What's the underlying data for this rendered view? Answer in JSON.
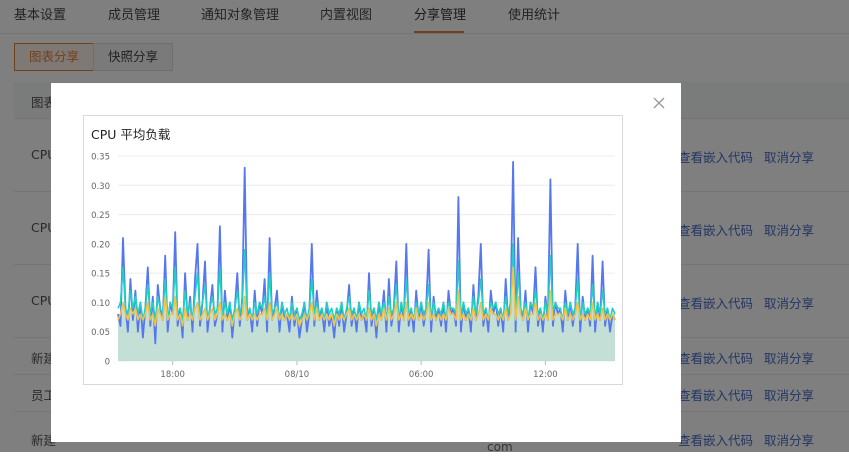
{
  "tabs": [
    {
      "label": "基本设置"
    },
    {
      "label": "成员管理"
    },
    {
      "label": "通知对象管理"
    },
    {
      "label": "内置视图"
    },
    {
      "label": "分享管理"
    },
    {
      "label": "使用统计"
    }
  ],
  "subtabs": [
    {
      "label": "图表分享",
      "active": true
    },
    {
      "label": "快照分享",
      "active": false
    }
  ],
  "table": {
    "header": "图表",
    "rows": [
      {
        "name": "CPU",
        "view_code": "查看嵌入代码",
        "cancel": "取消分享"
      },
      {
        "name": "CPU",
        "view_code": "查看嵌入代码",
        "cancel": "取消分享"
      },
      {
        "name": "CPU",
        "view_code": "查看嵌入代码",
        "cancel": "取消分享"
      },
      {
        "name": "新建",
        "view_code": "查看嵌入代码",
        "cancel": "取消分享"
      },
      {
        "name": "员工",
        "view_code": "查看嵌入代码",
        "cancel": "取消分享"
      },
      {
        "name": "新建",
        "view_code": "查看嵌入代码",
        "cancel": "取消分享",
        "extra": "com"
      }
    ]
  },
  "colors": {
    "accent": "#e6803a",
    "link": "#4a6cc9",
    "series_blue": "#5577f0",
    "series_cyan": "#21d0c2",
    "series_yellow": "#f0c24a",
    "area_fill": "#b9d9cf"
  },
  "icons": {
    "close": "close-icon"
  },
  "chart_data": {
    "type": "line",
    "title": "CPU 平均负载",
    "ylim": [
      0,
      0.35
    ],
    "yticks": [
      "0",
      "0.05",
      "0.10",
      "0.15",
      "0.20",
      "0.25",
      "0.30",
      "0.35"
    ],
    "xticks": [
      {
        "label": "18:00",
        "pos": 0.11
      },
      {
        "label": "08/10",
        "pos": 0.36
      },
      {
        "label": "06:00",
        "pos": 0.61
      },
      {
        "label": "12:00",
        "pos": 0.86
      }
    ],
    "grid": true,
    "series": [
      {
        "key": "s1",
        "color": "#5577f0",
        "values": [
          0.08,
          0.06,
          0.21,
          0.09,
          0.05,
          0.14,
          0.07,
          0.12,
          0.05,
          0.1,
          0.04,
          0.09,
          0.16,
          0.06,
          0.11,
          0.03,
          0.13,
          0.09,
          0.07,
          0.18,
          0.05,
          0.1,
          0.08,
          0.22,
          0.06,
          0.09,
          0.04,
          0.15,
          0.07,
          0.11,
          0.05,
          0.14,
          0.2,
          0.06,
          0.1,
          0.17,
          0.05,
          0.09,
          0.13,
          0.06,
          0.08,
          0.23,
          0.05,
          0.12,
          0.07,
          0.1,
          0.04,
          0.09,
          0.15,
          0.06,
          0.11,
          0.33,
          0.07,
          0.09,
          0.05,
          0.12,
          0.06,
          0.1,
          0.08,
          0.14,
          0.05,
          0.21,
          0.07,
          0.09,
          0.12,
          0.05,
          0.1,
          0.07,
          0.08,
          0.05,
          0.11,
          0.06,
          0.09,
          0.04,
          0.07,
          0.1,
          0.05,
          0.08,
          0.2,
          0.06,
          0.12,
          0.07,
          0.09,
          0.05,
          0.1,
          0.06,
          0.08,
          0.04,
          0.09,
          0.06,
          0.1,
          0.05,
          0.08,
          0.13,
          0.06,
          0.09,
          0.05,
          0.1,
          0.07,
          0.08,
          0.05,
          0.15,
          0.06,
          0.09,
          0.04,
          0.1,
          0.07,
          0.12,
          0.05,
          0.14,
          0.06,
          0.09,
          0.17,
          0.05,
          0.1,
          0.07,
          0.2,
          0.06,
          0.09,
          0.05,
          0.12,
          0.07,
          0.1,
          0.06,
          0.09,
          0.19,
          0.05,
          0.11,
          0.07,
          0.09,
          0.06,
          0.1,
          0.05,
          0.12,
          0.08,
          0.09,
          0.06,
          0.28,
          0.05,
          0.1,
          0.07,
          0.09,
          0.05,
          0.13,
          0.07,
          0.11,
          0.2,
          0.06,
          0.09,
          0.05,
          0.12,
          0.08,
          0.1,
          0.06,
          0.09,
          0.05,
          0.14,
          0.07,
          0.1,
          0.34,
          0.05,
          0.21,
          0.09,
          0.07,
          0.12,
          0.05,
          0.1,
          0.08,
          0.16,
          0.06,
          0.09,
          0.05,
          0.11,
          0.07,
          0.31,
          0.06,
          0.1,
          0.08,
          0.09,
          0.05,
          0.12,
          0.07,
          0.1,
          0.06,
          0.09,
          0.2,
          0.05,
          0.11,
          0.07,
          0.09,
          0.06,
          0.18,
          0.05,
          0.1,
          0.07,
          0.17,
          0.06,
          0.09,
          0.05,
          0.08,
          0.07
        ]
      },
      {
        "key": "s2",
        "color": "#21d0c2",
        "values": [
          0.09,
          0.1,
          0.16,
          0.09,
          0.08,
          0.12,
          0.09,
          0.11,
          0.08,
          0.1,
          0.07,
          0.09,
          0.13,
          0.08,
          0.1,
          0.07,
          0.11,
          0.09,
          0.08,
          0.14,
          0.07,
          0.1,
          0.09,
          0.16,
          0.08,
          0.09,
          0.07,
          0.12,
          0.08,
          0.1,
          0.07,
          0.11,
          0.15,
          0.08,
          0.1,
          0.13,
          0.07,
          0.09,
          0.11,
          0.08,
          0.09,
          0.16,
          0.07,
          0.1,
          0.08,
          0.1,
          0.07,
          0.09,
          0.12,
          0.08,
          0.1,
          0.19,
          0.08,
          0.09,
          0.07,
          0.1,
          0.08,
          0.1,
          0.09,
          0.11,
          0.07,
          0.15,
          0.08,
          0.09,
          0.1,
          0.07,
          0.1,
          0.08,
          0.09,
          0.07,
          0.1,
          0.08,
          0.09,
          0.07,
          0.08,
          0.1,
          0.07,
          0.09,
          0.14,
          0.08,
          0.1,
          0.08,
          0.09,
          0.07,
          0.1,
          0.08,
          0.09,
          0.07,
          0.09,
          0.08,
          0.1,
          0.07,
          0.09,
          0.11,
          0.08,
          0.09,
          0.07,
          0.1,
          0.08,
          0.09,
          0.07,
          0.12,
          0.08,
          0.09,
          0.07,
          0.1,
          0.08,
          0.1,
          0.07,
          0.11,
          0.08,
          0.09,
          0.13,
          0.07,
          0.1,
          0.08,
          0.14,
          0.08,
          0.09,
          0.07,
          0.1,
          0.08,
          0.1,
          0.08,
          0.09,
          0.13,
          0.07,
          0.1,
          0.08,
          0.09,
          0.08,
          0.1,
          0.07,
          0.1,
          0.09,
          0.09,
          0.08,
          0.17,
          0.07,
          0.1,
          0.08,
          0.09,
          0.07,
          0.11,
          0.08,
          0.1,
          0.14,
          0.08,
          0.09,
          0.07,
          0.1,
          0.09,
          0.1,
          0.08,
          0.09,
          0.07,
          0.11,
          0.08,
          0.1,
          0.2,
          0.07,
          0.15,
          0.09,
          0.08,
          0.1,
          0.07,
          0.1,
          0.09,
          0.12,
          0.08,
          0.09,
          0.07,
          0.1,
          0.08,
          0.18,
          0.08,
          0.1,
          0.09,
          0.09,
          0.07,
          0.1,
          0.08,
          0.1,
          0.08,
          0.09,
          0.14,
          0.07,
          0.1,
          0.08,
          0.09,
          0.08,
          0.13,
          0.07,
          0.1,
          0.08,
          0.12,
          0.08,
          0.09,
          0.07,
          0.09,
          0.08
        ]
      },
      {
        "key": "s3",
        "color": "#f0c24a",
        "values": [
          0.07,
          0.08,
          0.1,
          0.08,
          0.07,
          0.09,
          0.08,
          0.09,
          0.07,
          0.08,
          0.07,
          0.08,
          0.1,
          0.07,
          0.08,
          0.06,
          0.09,
          0.08,
          0.07,
          0.11,
          0.07,
          0.08,
          0.08,
          0.11,
          0.07,
          0.08,
          0.06,
          0.09,
          0.07,
          0.08,
          0.07,
          0.09,
          0.1,
          0.07,
          0.08,
          0.09,
          0.07,
          0.08,
          0.09,
          0.07,
          0.08,
          0.1,
          0.07,
          0.08,
          0.07,
          0.08,
          0.06,
          0.08,
          0.09,
          0.07,
          0.08,
          0.11,
          0.07,
          0.08,
          0.07,
          0.08,
          0.07,
          0.08,
          0.08,
          0.09,
          0.07,
          0.1,
          0.07,
          0.08,
          0.09,
          0.07,
          0.08,
          0.07,
          0.08,
          0.07,
          0.08,
          0.07,
          0.08,
          0.06,
          0.07,
          0.08,
          0.07,
          0.08,
          0.1,
          0.07,
          0.09,
          0.07,
          0.08,
          0.07,
          0.08,
          0.07,
          0.08,
          0.06,
          0.08,
          0.07,
          0.08,
          0.07,
          0.08,
          0.09,
          0.07,
          0.08,
          0.07,
          0.08,
          0.07,
          0.08,
          0.07,
          0.09,
          0.07,
          0.08,
          0.06,
          0.08,
          0.07,
          0.09,
          0.07,
          0.09,
          0.07,
          0.08,
          0.1,
          0.07,
          0.08,
          0.07,
          0.1,
          0.07,
          0.08,
          0.07,
          0.09,
          0.07,
          0.08,
          0.07,
          0.08,
          0.1,
          0.07,
          0.08,
          0.07,
          0.08,
          0.07,
          0.08,
          0.07,
          0.09,
          0.08,
          0.08,
          0.07,
          0.12,
          0.07,
          0.08,
          0.07,
          0.08,
          0.07,
          0.09,
          0.07,
          0.08,
          0.1,
          0.07,
          0.08,
          0.07,
          0.09,
          0.08,
          0.08,
          0.07,
          0.08,
          0.07,
          0.09,
          0.07,
          0.08,
          0.16,
          0.07,
          0.11,
          0.08,
          0.07,
          0.09,
          0.07,
          0.08,
          0.08,
          0.1,
          0.07,
          0.08,
          0.07,
          0.08,
          0.07,
          0.12,
          0.07,
          0.08,
          0.08,
          0.08,
          0.07,
          0.09,
          0.07,
          0.08,
          0.07,
          0.08,
          0.1,
          0.07,
          0.08,
          0.07,
          0.08,
          0.07,
          0.1,
          0.07,
          0.08,
          0.07,
          0.09,
          0.07,
          0.08,
          0.07,
          0.08,
          0.07
        ]
      },
      {
        "key": "area",
        "color": "#b9d9cf",
        "values": [
          0.08,
          0.08,
          0.1,
          0.08,
          0.08,
          0.09,
          0.08,
          0.09,
          0.08,
          0.08,
          0.07,
          0.08,
          0.1,
          0.08,
          0.08,
          0.07,
          0.09,
          0.08,
          0.08,
          0.1,
          0.07,
          0.08,
          0.08,
          0.11,
          0.08,
          0.08,
          0.07,
          0.09,
          0.08,
          0.08,
          0.07,
          0.09,
          0.1,
          0.08,
          0.08,
          0.09,
          0.07,
          0.08,
          0.09,
          0.08,
          0.08,
          0.1,
          0.07,
          0.08,
          0.08,
          0.08,
          0.07,
          0.08,
          0.09,
          0.08,
          0.08,
          0.11,
          0.08,
          0.08,
          0.07,
          0.08,
          0.08,
          0.08,
          0.08,
          0.09,
          0.07,
          0.1,
          0.08,
          0.08,
          0.09,
          0.07,
          0.08,
          0.08,
          0.08,
          0.07,
          0.08,
          0.08,
          0.08,
          0.07,
          0.08,
          0.08,
          0.07,
          0.08,
          0.1,
          0.08,
          0.09,
          0.08,
          0.08,
          0.07,
          0.08,
          0.08,
          0.08,
          0.07,
          0.08,
          0.08,
          0.08,
          0.07,
          0.08,
          0.09,
          0.08,
          0.08,
          0.07,
          0.08,
          0.08,
          0.08,
          0.07,
          0.09,
          0.08,
          0.08,
          0.07,
          0.08,
          0.08,
          0.09,
          0.07,
          0.09,
          0.08,
          0.08,
          0.1,
          0.07,
          0.08,
          0.08,
          0.1,
          0.08,
          0.08,
          0.07,
          0.09,
          0.08,
          0.08,
          0.08,
          0.08,
          0.1,
          0.07,
          0.08,
          0.08,
          0.08,
          0.08,
          0.08,
          0.07,
          0.09,
          0.08,
          0.08,
          0.08,
          0.11,
          0.07,
          0.08,
          0.08,
          0.08,
          0.07,
          0.09,
          0.08,
          0.08,
          0.1,
          0.08,
          0.08,
          0.07,
          0.09,
          0.08,
          0.08,
          0.08,
          0.08,
          0.07,
          0.09,
          0.08,
          0.08,
          0.12,
          0.07,
          0.1,
          0.08,
          0.08,
          0.09,
          0.07,
          0.08,
          0.08,
          0.1,
          0.08,
          0.08,
          0.07,
          0.08,
          0.08,
          0.11,
          0.08,
          0.08,
          0.08,
          0.08,
          0.07,
          0.09,
          0.08,
          0.08,
          0.08,
          0.08,
          0.1,
          0.07,
          0.08,
          0.08,
          0.08,
          0.08,
          0.09,
          0.07,
          0.08,
          0.08,
          0.09,
          0.08,
          0.08,
          0.07,
          0.08,
          0.08
        ]
      }
    ]
  }
}
